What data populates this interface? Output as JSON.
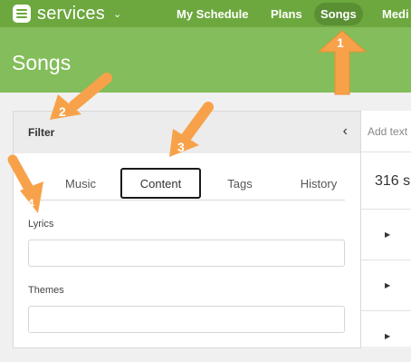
{
  "app": {
    "brand": "services"
  },
  "nav": {
    "items": [
      "My Schedule",
      "Plans",
      "Songs",
      "Medi"
    ],
    "active": "Songs"
  },
  "page": {
    "title": "Songs"
  },
  "filter": {
    "title": "Filter",
    "collapse_icon": "chevron-left-icon",
    "tabs": [
      "Music",
      "Content",
      "Tags",
      "History"
    ],
    "active_tab": "Content",
    "fields": [
      {
        "label": "Lyrics",
        "value": "",
        "placeholder": ""
      },
      {
        "label": "Themes",
        "value": "",
        "placeholder": ""
      }
    ]
  },
  "list": {
    "search_placeholder": "Add text",
    "count": "316 s",
    "rows": [
      "",
      "",
      ""
    ]
  },
  "annotations": {
    "markers": [
      "1",
      "2",
      "3",
      "4"
    ],
    "color": "#f7a24a"
  },
  "colors": {
    "topbar": "#6da83f",
    "header": "#84bd5b",
    "active_nav": "#5a8f34"
  }
}
